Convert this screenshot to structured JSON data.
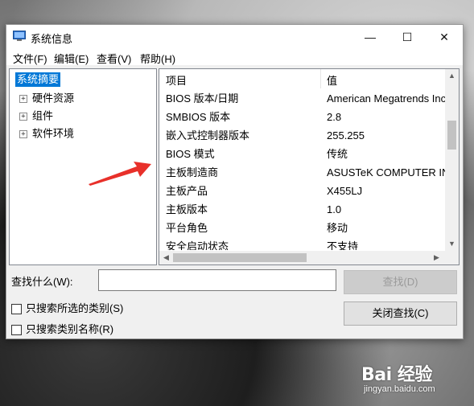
{
  "window": {
    "title": "系统信息",
    "minimize_glyph": "—",
    "maximize_glyph": "☐",
    "close_glyph": "✕"
  },
  "menu": {
    "items": [
      "文件(F)",
      "编辑(E)",
      "查看(V)",
      "帮助(H)"
    ]
  },
  "tree": {
    "root": "系统摘要",
    "nodes": [
      {
        "label": "硬件资源",
        "expander": "+"
      },
      {
        "label": "组件",
        "expander": "+"
      },
      {
        "label": "软件环境",
        "expander": "+"
      }
    ]
  },
  "list": {
    "header": {
      "item": "项目",
      "value": "值"
    },
    "rows": [
      {
        "item": "BIOS 版本/日期",
        "value": "American Megatrends Inc."
      },
      {
        "item": "SMBIOS 版本",
        "value": "2.8"
      },
      {
        "item": "嵌入式控制器版本",
        "value": "255.255"
      },
      {
        "item": "BIOS 模式",
        "value": "传统"
      },
      {
        "item": "主板制造商",
        "value": "ASUSTeK COMPUTER INC."
      },
      {
        "item": "主板产品",
        "value": "X455LJ"
      },
      {
        "item": "主板版本",
        "value": "1.0"
      },
      {
        "item": "平台角色",
        "value": "移动"
      },
      {
        "item": "安全启动状态",
        "value": "不支持"
      }
    ]
  },
  "search": {
    "label": "查找什么(W):",
    "value": "",
    "find_button": "查找(D)",
    "close_find_button": "关闭查找(C)",
    "option_selected_category": "只搜索所选的类别(S)",
    "option_category_names": "只搜索类别名称(R)"
  },
  "watermark": {
    "logo": "Bai 经验",
    "url": "jingyan.baidu.com"
  },
  "colors": {
    "selection": "#0078d7",
    "annotation_arrow": "#e8302a"
  }
}
